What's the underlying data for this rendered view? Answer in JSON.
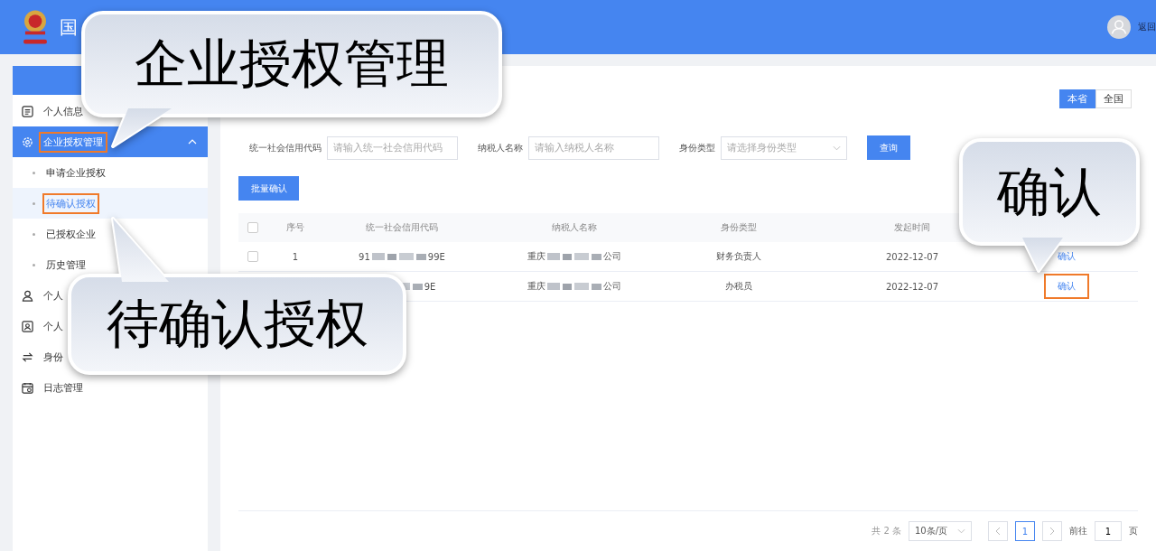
{
  "header": {
    "title": "国",
    "back_link": "返回"
  },
  "sidebar": {
    "items": [
      {
        "label": "个人信息",
        "highlighted": false,
        "selected": false
      },
      {
        "label": "企业授权管理",
        "expanded": true,
        "highlighted": true,
        "selected": true,
        "children": [
          {
            "label": "申请企业授权",
            "selected": false,
            "highlighted": false
          },
          {
            "label": "待确认授权",
            "selected": true,
            "highlighted": true
          },
          {
            "label": "已授权企业",
            "selected": false,
            "highlighted": false
          },
          {
            "label": "历史管理",
            "selected": false,
            "highlighted": false
          }
        ]
      },
      {
        "label": "个人",
        "highlighted": false,
        "selected": false
      },
      {
        "label": "个人",
        "highlighted": false,
        "selected": false
      },
      {
        "label": "身份",
        "highlighted": false,
        "selected": false
      },
      {
        "label": "日志管理",
        "highlighted": false,
        "selected": false
      }
    ]
  },
  "scope_toggle": [
    {
      "label": "本省",
      "selected": true
    },
    {
      "label": "全国",
      "selected": false
    }
  ],
  "filters": [
    {
      "kind": "input",
      "label": "统一社会信用代码",
      "placeholder": "请输入统一社会信用代码"
    },
    {
      "kind": "input",
      "label": "纳税人名称",
      "placeholder": "请输入纳税人名称"
    },
    {
      "kind": "select",
      "label": "身份类型",
      "placeholder": "请选择身份类型"
    }
  ],
  "search_button": "查询",
  "batch_button": "批量确认",
  "table": {
    "select_all_checked": false,
    "columns": [
      "序号",
      "统一社会信用代码",
      "纳税人名称",
      "身份类型",
      "发起时间"
    ],
    "rows": [
      {
        "checked": false,
        "index": "1",
        "code": {
          "prefix": "91",
          "suffix": "99E"
        },
        "name": {
          "prefix": "重庆",
          "suffix": "公司"
        },
        "identity": "财务负责人",
        "date": "2022-12-07",
        "action": "确认",
        "highlighted": false
      },
      {
        "code": {
          "suffix": "9E"
        },
        "name": {
          "prefix": "重庆",
          "suffix": "公司"
        },
        "identity": "办税员",
        "date": "2022-12-07",
        "action": "确认",
        "highlighted": true
      }
    ]
  },
  "pagination": {
    "total": "共 2 条",
    "page_size": "10条/页",
    "pages": [
      {
        "label": "1",
        "selected": true
      }
    ],
    "goto_label": "前往",
    "goto_value": "1",
    "goto_suffix": "页"
  },
  "callouts": [
    {
      "text": "企业授权管理",
      "kind": "down-left"
    },
    {
      "text": "待确认授权",
      "kind": "up-left"
    },
    {
      "text": "确认",
      "kind": "down-right"
    }
  ]
}
